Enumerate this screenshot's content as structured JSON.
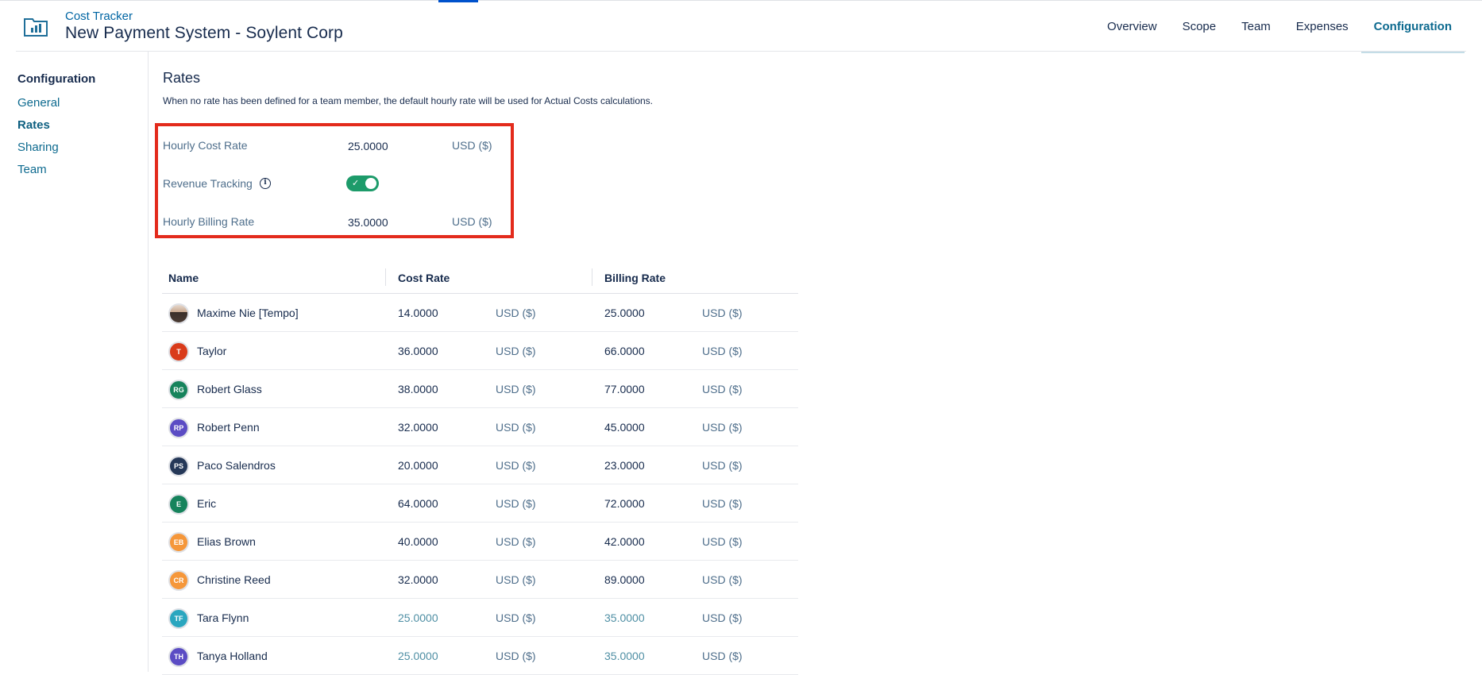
{
  "header": {
    "app_name": "Cost Tracker",
    "project_title": "New Payment System - Soylent Corp",
    "tabs": [
      {
        "label": "Overview"
      },
      {
        "label": "Scope"
      },
      {
        "label": "Team"
      },
      {
        "label": "Expenses"
      },
      {
        "label": "Configuration",
        "active": true
      }
    ]
  },
  "sidebar": {
    "title": "Configuration",
    "items": [
      {
        "label": "General"
      },
      {
        "label": "Rates",
        "active": true
      },
      {
        "label": "Sharing"
      },
      {
        "label": "Team"
      }
    ]
  },
  "rates": {
    "title": "Rates",
    "description": "When no rate has been defined for a team member, the default hourly rate will be used for Actual Costs calculations.",
    "hourly_cost_label": "Hourly Cost Rate",
    "hourly_cost_value": "25.0000",
    "hourly_cost_unit": "USD ($)",
    "revenue_tracking_label": "Revenue Tracking",
    "revenue_tracking_enabled": true,
    "info_glyph": "i",
    "toggle_check": "✓",
    "hourly_billing_label": "Hourly Billing Rate",
    "hourly_billing_value": "35.0000",
    "hourly_billing_unit": "USD ($)"
  },
  "table": {
    "columns": {
      "name": "Name",
      "cost_rate": "Cost Rate",
      "billing_rate": "Billing Rate"
    },
    "rows": [
      {
        "name": "Maxime Nie [Tempo]",
        "initials": "",
        "avatar_color": "",
        "cost": "14.0000",
        "cost_unit": "USD ($)",
        "billing": "25.0000",
        "billing_unit": "USD ($)",
        "uses_default": false
      },
      {
        "name": "Taylor",
        "initials": "T",
        "avatar_color": "#d93b1a",
        "cost": "36.0000",
        "cost_unit": "USD ($)",
        "billing": "66.0000",
        "billing_unit": "USD ($)",
        "uses_default": false
      },
      {
        "name": "Robert Glass",
        "initials": "RG",
        "avatar_color": "#16835c",
        "cost": "38.0000",
        "cost_unit": "USD ($)",
        "billing": "77.0000",
        "billing_unit": "USD ($)",
        "uses_default": false
      },
      {
        "name": "Robert Penn",
        "initials": "RP",
        "avatar_color": "#5b4cc4",
        "cost": "32.0000",
        "cost_unit": "USD ($)",
        "billing": "45.0000",
        "billing_unit": "USD ($)",
        "uses_default": false
      },
      {
        "name": "Paco Salendros",
        "initials": "PS",
        "avatar_color": "#253858",
        "cost": "20.0000",
        "cost_unit": "USD ($)",
        "billing": "23.0000",
        "billing_unit": "USD ($)",
        "uses_default": false
      },
      {
        "name": "Eric",
        "initials": "E",
        "avatar_color": "#16835c",
        "cost": "64.0000",
        "cost_unit": "USD ($)",
        "billing": "72.0000",
        "billing_unit": "USD ($)",
        "uses_default": false
      },
      {
        "name": "Elias Brown",
        "initials": "EB",
        "avatar_color": "#f5973a",
        "cost": "40.0000",
        "cost_unit": "USD ($)",
        "billing": "42.0000",
        "billing_unit": "USD ($)",
        "uses_default": false
      },
      {
        "name": "Christine Reed",
        "initials": "CR",
        "avatar_color": "#f5973a",
        "cost": "32.0000",
        "cost_unit": "USD ($)",
        "billing": "89.0000",
        "billing_unit": "USD ($)",
        "uses_default": false
      },
      {
        "name": "Tara Flynn",
        "initials": "TF",
        "avatar_color": "#2aa6bf",
        "cost": "25.0000",
        "cost_unit": "USD ($)",
        "billing": "35.0000",
        "billing_unit": "USD ($)",
        "uses_default": true
      },
      {
        "name": "Tanya Holland",
        "initials": "TH",
        "avatar_color": "#5b4cc4",
        "cost": "25.0000",
        "cost_unit": "USD ($)",
        "billing": "35.0000",
        "billing_unit": "USD ($)",
        "uses_default": true
      }
    ]
  }
}
